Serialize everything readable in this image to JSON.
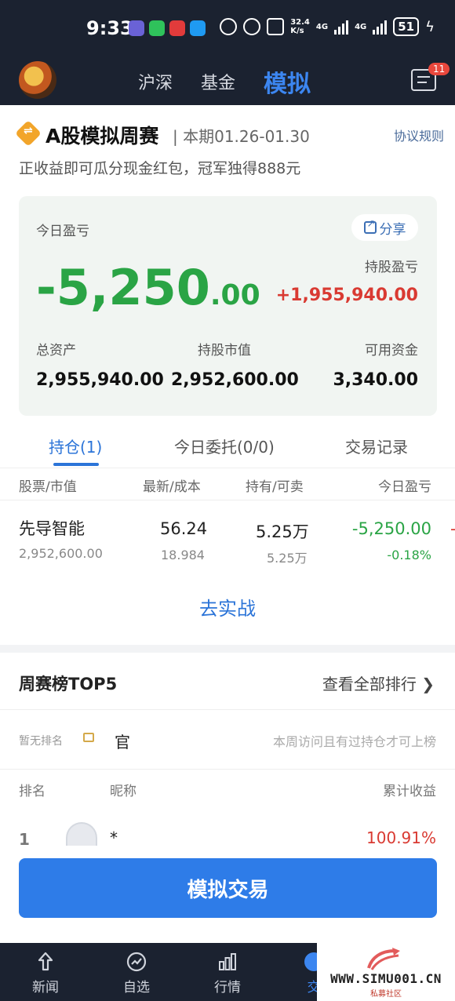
{
  "status_bar": {
    "time": "9:33",
    "net_speed_value": "32.4",
    "net_speed_unit": "K/s",
    "network_1": "4G",
    "network_2": "4G",
    "battery": "51"
  },
  "nav": {
    "tabs": [
      "沪深",
      "基金",
      "模拟"
    ],
    "active_tab": "模拟",
    "message_badge": "11"
  },
  "contest": {
    "title": "A股模拟周赛",
    "period": "| 本期01.26-01.30",
    "rules_link": "协议规则",
    "subtitle": "正收益即可瓜分现金红包，冠军独得888元"
  },
  "summary": {
    "today_pl_label": "今日盈亏",
    "share_label": "分享",
    "today_pl_int": "-5,250",
    "today_pl_dec": ".00",
    "holding_pl_label": "持股盈亏",
    "holding_pl_value": "+1,955,940.00",
    "total_assets_label": "总资产",
    "total_assets_value": "2,955,940.00",
    "market_value_label": "持股市值",
    "market_value_value": "2,952,600.00",
    "available_label": "可用资金",
    "available_value": "3,340.00"
  },
  "tabs": {
    "positions": "持仓(1)",
    "orders": "今日委托(0/0)",
    "history": "交易记录"
  },
  "table": {
    "headers": [
      "股票/市值",
      "最新/成本",
      "持有/可卖",
      "今日盈亏"
    ],
    "rows": [
      {
        "name": "先导智能",
        "market_value": "2,952,600.00",
        "price": "56.24",
        "cost": "18.984",
        "hold": "5.25万",
        "available": "5.25万",
        "today_pl": "-5,250.00",
        "today_pl_pct": "-0.18%",
        "overflow": "-"
      }
    ]
  },
  "go_real": "去实战",
  "leaderboard": {
    "title": "周赛榜TOP5",
    "view_all": "查看全部排行",
    "no_rank_label": "暂无排名",
    "my_name": "官",
    "no_rank_tip": "本周访问且有过持仓才可上榜",
    "headers": [
      "排名",
      "昵称",
      "累计收益"
    ],
    "rows": [
      {
        "rank": "1",
        "nickname": "*",
        "return": "100.91%"
      }
    ]
  },
  "sim_trade_button": "模拟交易",
  "bottom_nav": {
    "items": [
      "新闻",
      "自选",
      "行情",
      "交"
    ]
  },
  "watermark": {
    "url": "WWW.SIMU001.CN",
    "sub": "私募社区"
  },
  "colors": {
    "nav_bg": "#1b2230",
    "accent": "#2e7ce8",
    "loss_green": "#2aa445",
    "gain_red": "#d93a32"
  }
}
